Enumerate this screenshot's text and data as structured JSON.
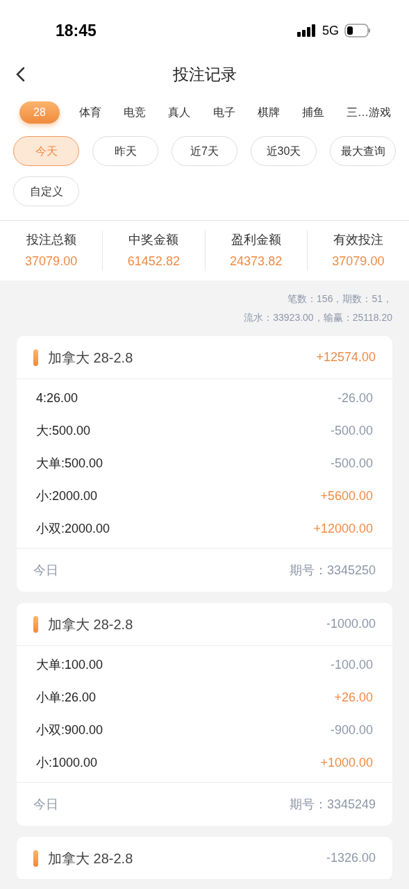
{
  "status_bar": {
    "time": "18:45",
    "network": "5G"
  },
  "header": {
    "title": "投注记录"
  },
  "tabs": [
    {
      "label": "28",
      "selected": true
    },
    {
      "label": "体育",
      "selected": false
    },
    {
      "label": "电竞",
      "selected": false
    },
    {
      "label": "真人",
      "selected": false
    },
    {
      "label": "电子",
      "selected": false
    },
    {
      "label": "棋牌",
      "selected": false
    },
    {
      "label": "捕鱼",
      "selected": false
    },
    {
      "label": "三…游戏",
      "selected": false
    }
  ],
  "date_filters": [
    {
      "label": "今天",
      "selected": true
    },
    {
      "label": "昨天",
      "selected": false
    },
    {
      "label": "近7天",
      "selected": false
    },
    {
      "label": "近30天",
      "selected": false
    },
    {
      "label": "最大查询",
      "selected": false
    },
    {
      "label": "自定义",
      "selected": false
    }
  ],
  "summary": [
    {
      "label": "投注总额",
      "value": "37079.00"
    },
    {
      "label": "中奖金额",
      "value": "61452.82"
    },
    {
      "label": "盈利金额",
      "value": "24373.82"
    },
    {
      "label": "有效投注",
      "value": "37079.00"
    }
  ],
  "stats": [
    "笔数：156，期数：51，",
    "流水：33923.00，输赢：25118.20"
  ],
  "records": [
    {
      "title": "加拿大 28-2.8",
      "total": "+12574.00",
      "kind": "gain",
      "bets": [
        {
          "bet": "4:26.00",
          "result": "-26.00",
          "kind": "loss"
        },
        {
          "bet": "大:500.00",
          "result": "-500.00",
          "kind": "loss"
        },
        {
          "bet": "大单:500.00",
          "result": "-500.00",
          "kind": "loss"
        },
        {
          "bet": "小:2000.00",
          "result": "+5600.00",
          "kind": "gain"
        },
        {
          "bet": "小双:2000.00",
          "result": "+12000.00",
          "kind": "gain"
        }
      ],
      "day": "今日",
      "issue": "期号：3345250"
    },
    {
      "title": "加拿大 28-2.8",
      "total": "-1000.00",
      "kind": "loss",
      "bets": [
        {
          "bet": "大单:100.00",
          "result": "-100.00",
          "kind": "loss"
        },
        {
          "bet": "小单:26.00",
          "result": "+26.00",
          "kind": "gain"
        },
        {
          "bet": "小双:900.00",
          "result": "-900.00",
          "kind": "loss"
        },
        {
          "bet": "小:1000.00",
          "result": "+1000.00",
          "kind": "gain"
        }
      ],
      "day": "今日",
      "issue": "期号：3345249"
    },
    {
      "title": "加拿大 28-2.8",
      "total": "-1326.00",
      "kind": "loss"
    }
  ]
}
